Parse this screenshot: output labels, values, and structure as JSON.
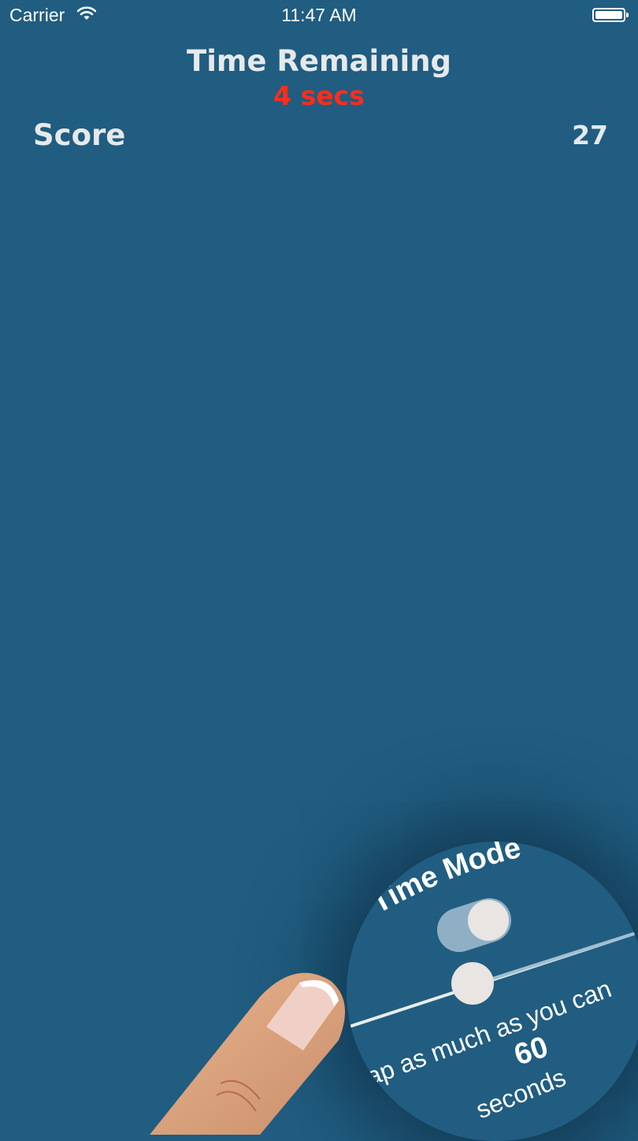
{
  "status_bar": {
    "carrier": "Carrier",
    "time": "11:47 AM"
  },
  "game": {
    "time_title": "Time Remaining",
    "time_value": "4 secs",
    "score_label": "Score",
    "score_value": "27"
  },
  "app_icon": {
    "title": "Time Mode",
    "line1": "ap as much as you can",
    "number": "60",
    "unit": "seconds"
  },
  "colors": {
    "background": "#205d80",
    "text": "#e6e9eb",
    "countdown": "#ff2d1a"
  }
}
